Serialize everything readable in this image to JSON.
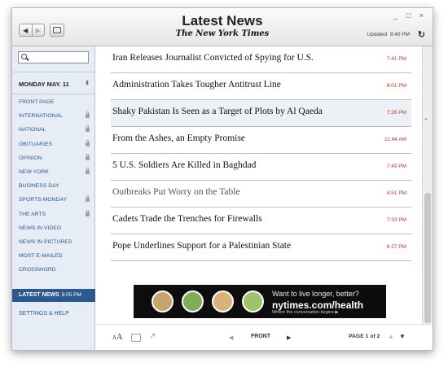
{
  "header": {
    "title": "Latest News",
    "masthead": "The New York Times",
    "updated_label": "Updated",
    "updated_time": "9:40 PM",
    "window_controls": "_ □ ×",
    "refresh_icon": "refresh-icon"
  },
  "sidebar": {
    "search_value": "",
    "date": "MONDAY MAY. 11",
    "date_stepper": "⇕",
    "sections": [
      {
        "label": "FRONT PAGE",
        "locked": false
      },
      {
        "label": "INTERNATIONAL",
        "locked": true
      },
      {
        "label": "NATIONAL",
        "locked": true
      },
      {
        "label": "OBITUARIES",
        "locked": true
      },
      {
        "label": "OPINION",
        "locked": true
      },
      {
        "label": "NEW YORK",
        "locked": true
      },
      {
        "label": "BUSINESS DAY",
        "locked": false
      },
      {
        "label": "SPORTS MONDAY",
        "locked": true
      },
      {
        "label": "THE ARTS",
        "locked": true
      },
      {
        "label": "NEWS IN VIDEO",
        "locked": false
      },
      {
        "label": "NEWS IN PICTURES",
        "locked": false
      },
      {
        "label": "MOST E-MAILED",
        "locked": false
      },
      {
        "label": "CROSSWORD",
        "locked": false
      }
    ],
    "latest_label": "LATEST NEWS",
    "latest_time": "8:05 PM",
    "settings_label": "SETTINGS & HELP"
  },
  "stories": [
    {
      "headline": "Iran Releases Journalist Convicted of Spying for U.S.",
      "time": "7:41 PM"
    },
    {
      "headline": "Administration Takes Tougher Antitrust Line",
      "time": "8:01 PM"
    },
    {
      "headline": "Shaky Pakistan Is Seen as a Target of Plots by Al Qaeda",
      "time": "7:26 PM",
      "highlighted": true
    },
    {
      "headline": "From the Ashes, an Empty Promise",
      "time": "11:44 AM"
    },
    {
      "headline": "5 U.S. Soldiers Are Killed in Baghdad",
      "time": "7:49 PM"
    },
    {
      "headline": "Outbreaks Put Worry on the Table",
      "time": "4:51 PM",
      "dim": true
    },
    {
      "headline": "Cadets Trade the Trenches for Firewalls",
      "time": "7:33 PM"
    },
    {
      "headline": "Pope Underlines Support for a Palestinian State",
      "time": "6:27 PM"
    }
  ],
  "ad": {
    "line1": "Want to live longer, better?",
    "domain": "nytimes.com/health",
    "tagline": "Where the conversation begins ▶",
    "circle_colors": [
      "#c9a36a",
      "#7fae5a",
      "#d8b27a",
      "#9cc46a"
    ]
  },
  "bottom": {
    "font_size_label": "AA",
    "front_label": "FRONT",
    "page_indicator": "PAGE 1 of 2",
    "prev": "◀",
    "next": "▶",
    "up": "▲",
    "down": "▼"
  },
  "colors": {
    "accent": "#2c5a8e",
    "time_red": "#b53a2a",
    "sidebar_bg": "#e7edf4"
  }
}
